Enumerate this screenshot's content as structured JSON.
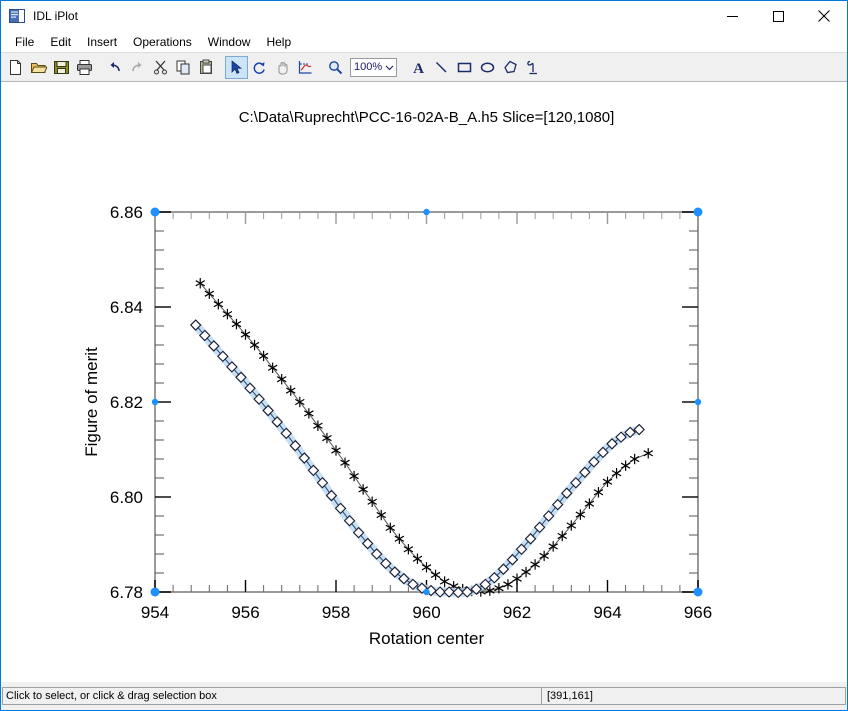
{
  "window": {
    "title": "IDL iPlot",
    "icon": "idl-app-icon",
    "buttons": [
      {
        "name": "minimize-button",
        "glyph": "minimize-icon"
      },
      {
        "name": "maximize-button",
        "glyph": "maximize-icon"
      },
      {
        "name": "close-button",
        "glyph": "close-icon"
      }
    ]
  },
  "menu": {
    "items": [
      {
        "label": "File"
      },
      {
        "label": "Edit"
      },
      {
        "label": "Insert"
      },
      {
        "label": "Operations"
      },
      {
        "label": "Window"
      },
      {
        "label": "Help"
      }
    ]
  },
  "toolbar": {
    "zoom_value": "100%",
    "buttons": [
      {
        "name": "new-button",
        "icon": "new-document-icon"
      },
      {
        "name": "open-button",
        "icon": "open-folder-icon"
      },
      {
        "name": "save-button",
        "icon": "floppy-disk-icon"
      },
      {
        "name": "print-button",
        "icon": "printer-icon"
      },
      {
        "name": "undo-button",
        "icon": "undo-arrow-icon"
      },
      {
        "name": "redo-button",
        "icon": "redo-arrow-icon"
      },
      {
        "name": "cut-button",
        "icon": "scissors-icon"
      },
      {
        "name": "copy-button",
        "icon": "copy-pages-icon"
      },
      {
        "name": "paste-button",
        "icon": "clipboard-icon"
      },
      {
        "name": "select-tool-button",
        "icon": "arrow-cursor-icon"
      },
      {
        "name": "rotate-tool-button",
        "icon": "rotate-icon"
      },
      {
        "name": "pan-tool-button",
        "icon": "hand-icon"
      },
      {
        "name": "data-tool-button",
        "icon": "plot-data-icon"
      },
      {
        "name": "zoom-tool-button",
        "icon": "magnifier-icon"
      },
      {
        "name": "text-tool-button",
        "icon": "text-a-icon"
      },
      {
        "name": "line-tool-button",
        "icon": "line-icon"
      },
      {
        "name": "rectangle-tool-button",
        "icon": "rectangle-icon"
      },
      {
        "name": "ellipse-tool-button",
        "icon": "ellipse-icon"
      },
      {
        "name": "polygon-tool-button",
        "icon": "polygon-icon"
      },
      {
        "name": "freehand-tool-button",
        "icon": "freehand-icon"
      }
    ]
  },
  "statusbar": {
    "message": "Click to select, or click & drag selection box",
    "coordinates": "[391,161]"
  },
  "chart_data": {
    "type": "line",
    "title": "C:\\Data\\Ruprecht\\PCC-16-02A-B_A.h5   Slice=[120,1080]",
    "xlabel": "Rotation center",
    "ylabel": "Figure of merit",
    "xlim": [
      954,
      966
    ],
    "ylim": [
      6.78,
      6.86
    ],
    "xticks": [
      954,
      956,
      958,
      960,
      962,
      964,
      966
    ],
    "xtick_labels": [
      "954",
      "956",
      "958",
      "960",
      "962",
      "964",
      "966"
    ],
    "yticks": [
      6.78,
      6.8,
      6.82,
      6.84,
      6.86
    ],
    "ytick_labels": [
      "6.78",
      "6.80",
      "6.82",
      "6.84",
      "6.86"
    ],
    "x_minor_per_major": 4,
    "y_minor_per_major": 4,
    "grid": false,
    "legend": "none",
    "selected_series": "figure-of-merit-diamond",
    "series": [
      {
        "name": "figure-of-merit-star",
        "marker": "star",
        "color": "#000000",
        "selected": false,
        "x": [
          955.0,
          955.2,
          955.4,
          955.6,
          955.8,
          956.0,
          956.2,
          956.4,
          956.6,
          956.8,
          957.0,
          957.2,
          957.4,
          957.6,
          957.8,
          958.0,
          958.2,
          958.4,
          958.6,
          958.8,
          959.0,
          959.2,
          959.4,
          959.6,
          959.8,
          960.0,
          960.2,
          960.4,
          960.6,
          960.8,
          961.0,
          961.2,
          961.4,
          961.6,
          961.8,
          962.0,
          962.2,
          962.4,
          962.6,
          962.8,
          963.0,
          963.2,
          963.4,
          963.6,
          963.8,
          964.0,
          964.2,
          964.4,
          964.6,
          964.9
        ],
        "y": [
          6.845,
          6.8428,
          6.8406,
          6.8385,
          6.8364,
          6.8342,
          6.832,
          6.8297,
          6.8272,
          6.8248,
          6.8224,
          6.82,
          6.8176,
          6.815,
          6.8124,
          6.8098,
          6.8072,
          6.8044,
          6.8016,
          6.799,
          6.7962,
          6.7935,
          6.7912,
          6.789,
          6.787,
          6.7852,
          6.7836,
          6.7822,
          6.7812,
          6.7806,
          6.7802,
          6.7801,
          6.7803,
          6.7808,
          6.7816,
          6.7828,
          6.7842,
          6.7858,
          6.7876,
          6.7896,
          6.7918,
          6.794,
          6.7963,
          6.7986,
          6.801,
          6.8032,
          6.805,
          6.8066,
          6.808,
          6.8092
        ]
      },
      {
        "name": "figure-of-merit-diamond",
        "marker": "diamond",
        "color": "#1a1a2e",
        "highlight_color": "#bcd9f0",
        "selected": true,
        "x": [
          954.9,
          955.1,
          955.3,
          955.5,
          955.7,
          955.9,
          956.1,
          956.3,
          956.5,
          956.7,
          956.9,
          957.1,
          957.3,
          957.5,
          957.7,
          957.9,
          958.1,
          958.3,
          958.5,
          958.7,
          958.9,
          959.1,
          959.3,
          959.5,
          959.7,
          959.9,
          960.1,
          960.3,
          960.5,
          960.7,
          960.9,
          961.1,
          961.3,
          961.5,
          961.7,
          961.9,
          962.1,
          962.3,
          962.5,
          962.7,
          962.9,
          963.1,
          963.3,
          963.5,
          963.7,
          963.9,
          964.1,
          964.3,
          964.5,
          964.7
        ],
        "y": [
          6.8362,
          6.834,
          6.8318,
          6.8296,
          6.8274,
          6.8252,
          6.8229,
          6.8206,
          6.8182,
          6.8158,
          6.8134,
          6.8108,
          6.8082,
          6.8056,
          6.803,
          6.8003,
          6.7976,
          6.795,
          6.7925,
          6.7902,
          6.788,
          6.786,
          6.7842,
          6.7828,
          6.7816,
          6.7808,
          6.7803,
          6.78,
          6.78,
          6.7799,
          6.78,
          6.7806,
          6.7816,
          6.783,
          6.7848,
          6.7868,
          6.789,
          6.7912,
          6.7936,
          6.796,
          6.7984,
          6.8008,
          6.803,
          6.8052,
          6.8074,
          6.8094,
          6.8112,
          6.8126,
          6.8136,
          6.8142
        ]
      }
    ],
    "selection_handles": {
      "color": "#1e90ff",
      "positions": [
        "top-left",
        "top-center",
        "top-right",
        "middle-left",
        "middle-right",
        "bottom-left",
        "bottom-center",
        "bottom-right"
      ]
    }
  }
}
